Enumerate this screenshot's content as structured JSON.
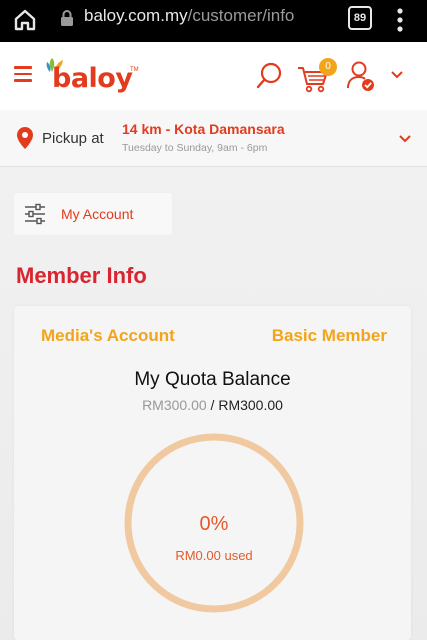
{
  "browser": {
    "url_host": "baloy.com.my",
    "url_path": "/customer/info",
    "tab_count": "89"
  },
  "header": {
    "logo_text": "baloy",
    "logo_tm": "TM",
    "cart_count": "0"
  },
  "pickup": {
    "label": "Pickup at",
    "location": "14 km - Kota Damansara",
    "hours": "Tuesday to Sunday, 9am - 6pm"
  },
  "nav": {
    "my_account_label": "My Account"
  },
  "page": {
    "title": "Member Info"
  },
  "member": {
    "account_name": "Media's Account",
    "tier": "Basic Member",
    "quota_title": "My Quota Balance",
    "balance": "RM300.00",
    "separator": " / ",
    "total": "RM300.00",
    "used_percent": "0%",
    "used_text": "RM0.00 used",
    "used_fraction": 0
  },
  "colors": {
    "brand": "#e23b1e",
    "title": "#d8252f",
    "accent": "#f2a51a",
    "ring": "#f1c9a0"
  }
}
